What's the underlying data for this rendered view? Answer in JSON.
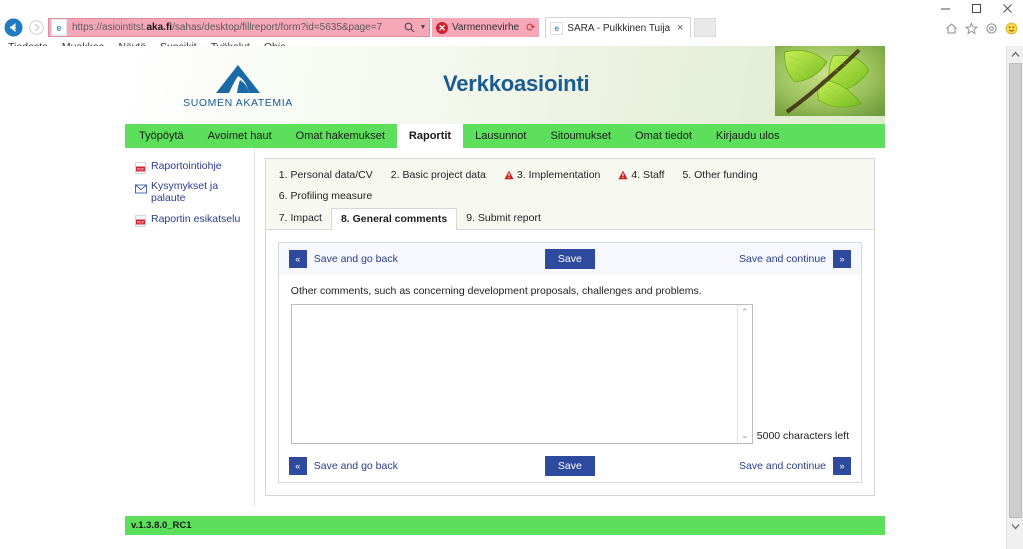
{
  "browser": {
    "url": "https://asiointitst.aka.fi/sahas/desktop/fillreport/form?id=5635&page=7",
    "url_prefix": "https://asiointitst.",
    "url_domain": "aka.fi",
    "url_suffix": "/sahas/desktop/fillreport/form?id=5635&page=7",
    "cert_error_label": "Varmennevirhe",
    "tab_title": "SARA - Pulkkinen Tuija",
    "menu": [
      "Tiedosto",
      "Muokkaa",
      "Näytä",
      "Suosikit",
      "Työkalut",
      "Ohje"
    ],
    "window_controls": {
      "minimize": "minimize-icon",
      "maximize": "maximize-icon",
      "close": "close-icon"
    },
    "toolbar_icons": [
      "home-icon",
      "favorites-star-icon",
      "settings-gear-icon",
      "smiley-feedback-icon"
    ]
  },
  "header": {
    "logo_text": "SUOMEN AKATEMIA",
    "title": "Verkkoasiointi"
  },
  "nav": {
    "items": [
      {
        "label": "Työpöytä",
        "active": false
      },
      {
        "label": "Avoimet haut",
        "active": false
      },
      {
        "label": "Omat hakemukset",
        "active": false
      },
      {
        "label": "Raportit",
        "active": true
      },
      {
        "label": "Lausunnot",
        "active": false
      },
      {
        "label": "Sitoumukset",
        "active": false
      },
      {
        "label": "Omat tiedot",
        "active": false
      },
      {
        "label": "Kirjaudu ulos",
        "active": false
      }
    ]
  },
  "sidebar": {
    "items": [
      {
        "label": "Raportointiohje",
        "icon": "pdf-icon"
      },
      {
        "label": "Kysymykset ja palaute",
        "icon": "envelope-icon"
      },
      {
        "label": "Raportin esikatselu",
        "icon": "pdf-icon"
      }
    ]
  },
  "steps": [
    {
      "label": "1. Personal data/CV",
      "warning": false,
      "active": false
    },
    {
      "label": "2. Basic project data",
      "warning": false,
      "active": false
    },
    {
      "label": "3. Implementation",
      "warning": true,
      "active": false
    },
    {
      "label": "4. Staff",
      "warning": true,
      "active": false
    },
    {
      "label": "5. Other funding",
      "warning": false,
      "active": false
    },
    {
      "label": "6. Profiling measure",
      "warning": false,
      "active": false
    },
    {
      "label": "7. Impact",
      "warning": false,
      "active": false
    },
    {
      "label": "8. General comments",
      "warning": false,
      "active": true
    },
    {
      "label": "9. Submit report",
      "warning": false,
      "active": false
    }
  ],
  "form": {
    "back_label": "Save and go back",
    "back_glyph": "«",
    "save_label": "Save",
    "continue_label": "Save and continue",
    "continue_glyph": "»",
    "field_label": "Other comments, such as concerning development proposals, challenges and problems.",
    "field_value": "",
    "field_placeholder": "",
    "characters_left": "5000 characters left",
    "scroll_up_glyph": "⌃",
    "scroll_down_glyph": "⌄"
  },
  "footer": {
    "version": "v.1.3.8.0_RC1"
  },
  "colors": {
    "nav_green": "#5ce05c",
    "brand_blue": "#1a5b92",
    "button_blue": "#2e4a9e",
    "link_blue": "#2b3d8f",
    "warning_red": "#cc2222",
    "url_bar_pink": "#f6a8b8"
  }
}
